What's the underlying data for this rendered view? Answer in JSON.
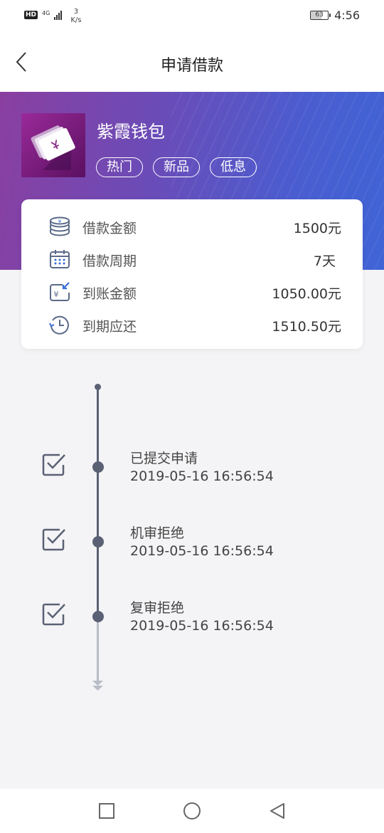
{
  "status_bar": {
    "hd": "HD",
    "network": "4G",
    "speed_value": "3",
    "speed_unit": "K/s",
    "battery": "63",
    "time": "4:56"
  },
  "nav": {
    "title": "申请借款",
    "back_icon": "chevron-left-icon"
  },
  "product": {
    "name": "紫霞钱包",
    "tags": [
      "热门",
      "新品",
      "低息"
    ],
    "logo_icon": "wallet-icon"
  },
  "loan_info": [
    {
      "label": "借款金额",
      "value": "1500元",
      "icon": "coins-icon"
    },
    {
      "label": "借款周期",
      "value": "7天",
      "icon": "calendar-icon"
    },
    {
      "label": "到账金额",
      "value": "1050.00元",
      "icon": "yen-receive-icon"
    },
    {
      "label": "到期应还",
      "value": "1510.50元",
      "icon": "clock-return-icon"
    }
  ],
  "timeline": [
    {
      "title": "已提交申请",
      "time": "2019-05-16 16:56:54"
    },
    {
      "title": "机审拒绝",
      "time": "2019-05-16 16:56:54"
    },
    {
      "title": "复审拒绝",
      "time": "2019-05-16 16:56:54"
    }
  ],
  "colors": {
    "hero_start": "#8a3fa0",
    "hero_end": "#3f64d6",
    "accent_icon": "#3a6fd8",
    "timeline": "#5a6174"
  }
}
